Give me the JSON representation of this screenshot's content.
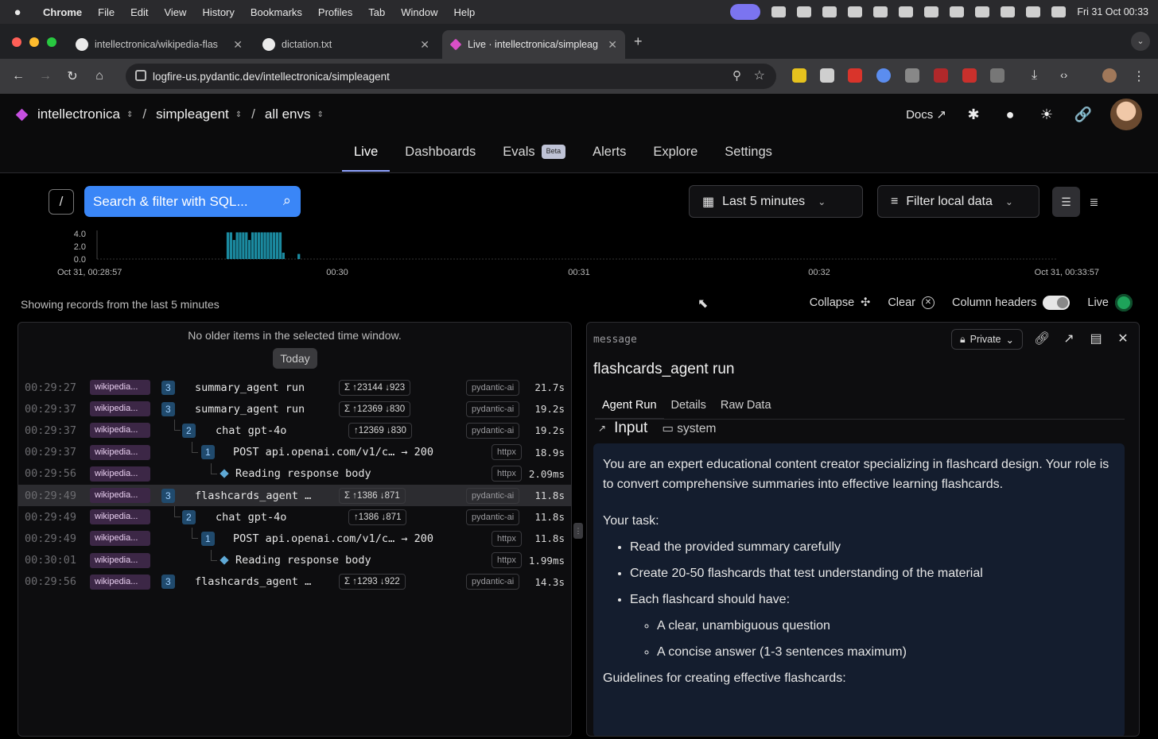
{
  "menubar": {
    "app": "Chrome",
    "items": [
      "File",
      "Edit",
      "View",
      "History",
      "Bookmarks",
      "Profiles",
      "Tab",
      "Window",
      "Help"
    ],
    "clock": "Fri 31 Oct  00:33"
  },
  "browser": {
    "tabs": [
      {
        "label": "intellectronica/wikipedia-flas",
        "icon": "github-icon"
      },
      {
        "label": "dictation.txt",
        "icon": "github-icon"
      },
      {
        "label": "Live · intellectronica/simpleag",
        "icon": "logfire-icon"
      }
    ],
    "url": "logfire-us.pydantic.dev/intellectronica/simpleagent"
  },
  "app": {
    "breadcrumbs": [
      "intellectronica",
      "simpleagent",
      "all envs"
    ],
    "docs_label": "Docs",
    "nav_tabs": [
      "Live",
      "Dashboards",
      "Evals",
      "Alerts",
      "Explore",
      "Settings"
    ],
    "beta_label": "Beta",
    "active_tab": "Live"
  },
  "filters": {
    "slash_key": "/",
    "search_placeholder": "Search & filter with SQL...",
    "time_range": "Last 5 minutes",
    "filter_local": "Filter local data"
  },
  "chart_data": {
    "type": "bar",
    "yticks": [
      "4.0",
      "2.0",
      "0.0"
    ],
    "xticks": [
      "Oct 31, 00:28:57",
      "00:30",
      "00:31",
      "00:32",
      "Oct 31, 00:33:57"
    ],
    "ylim": [
      0,
      4.5
    ],
    "bar_color": "#1b8aa0",
    "values": [
      0,
      0,
      0,
      0,
      0,
      0,
      0,
      0,
      0,
      0,
      0,
      0,
      0,
      0,
      0,
      0,
      0,
      0,
      0,
      0,
      0,
      0,
      0,
      0,
      0,
      0,
      0,
      0,
      0,
      0,
      0,
      0,
      0,
      0,
      0,
      0,
      0,
      0,
      0,
      0,
      0,
      0,
      4.2,
      4.2,
      3.0,
      4.2,
      4.2,
      4.2,
      4.2,
      3.0,
      4.2,
      4.2,
      4.2,
      4.2,
      4.2,
      4.2,
      4.2,
      4.2,
      4.2,
      4.2,
      1.0,
      0,
      0,
      0,
      0,
      0.8,
      0,
      0,
      0,
      0,
      0,
      0,
      0,
      0,
      0,
      0,
      0,
      0,
      0,
      0,
      0,
      0,
      0,
      0,
      0,
      0,
      0,
      0,
      0,
      0,
      0,
      0,
      0,
      0,
      0,
      0,
      0,
      0,
      0,
      0,
      0,
      0,
      0,
      0,
      0,
      0,
      0,
      0,
      0,
      0,
      0,
      0,
      0,
      0,
      0,
      0,
      0,
      0,
      0,
      0,
      0,
      0,
      0,
      0,
      0,
      0,
      0,
      0,
      0,
      0,
      0,
      0,
      0,
      0,
      0,
      0,
      0,
      0,
      0,
      0,
      0,
      0,
      0,
      0,
      0,
      0,
      0,
      0,
      0,
      0,
      0,
      0,
      0,
      0,
      0,
      0,
      0,
      0,
      0,
      0,
      0,
      0,
      0,
      0,
      0,
      0,
      0,
      0,
      0,
      0,
      0,
      0,
      0,
      0,
      0,
      0,
      0,
      0,
      0,
      0,
      0,
      0,
      0,
      0,
      0,
      0,
      0,
      0,
      0,
      0,
      0,
      0,
      0,
      0,
      0,
      0,
      0,
      0,
      0,
      0,
      0,
      0,
      0,
      0,
      0,
      0,
      0,
      0,
      0,
      0,
      0,
      0,
      0,
      0,
      0,
      0,
      0,
      0,
      0,
      0,
      0,
      0,
      0,
      0,
      0,
      0,
      0,
      0,
      0,
      0,
      0,
      0,
      0,
      0,
      0,
      0,
      0,
      0,
      0,
      0,
      0,
      0,
      0,
      0,
      0,
      0,
      0,
      0,
      0,
      0,
      0,
      0,
      0,
      0,
      0,
      0,
      0,
      0,
      0,
      0,
      0,
      0,
      0,
      0,
      0,
      0,
      0,
      0,
      0,
      0,
      0,
      0,
      0,
      0,
      0,
      0,
      0,
      0,
      0,
      0,
      0,
      0,
      0,
      0,
      0,
      0,
      0,
      0,
      0,
      0,
      0,
      0,
      0,
      0,
      0,
      0,
      0,
      0,
      0,
      0,
      0,
      0,
      0,
      0,
      0,
      0,
      0,
      0,
      0,
      0,
      0
    ]
  },
  "status": {
    "showing": "Showing records from the last 5 minutes",
    "collapse": "Collapse",
    "clear": "Clear",
    "column_headers": "Column headers",
    "live": "Live"
  },
  "log": {
    "no_older": "No older items in the selected time window.",
    "today": "Today",
    "rows": [
      {
        "time": "00:29:27",
        "service": "wikipedia...",
        "level": 0,
        "badge": "3",
        "name": "summary_agent run",
        "tokens": "Σ ↑23144 ↓923",
        "tag": "pydantic-ai",
        "duration": "21.7s",
        "selected": false
      },
      {
        "time": "00:29:37",
        "service": "wikipedia...",
        "level": 0,
        "badge": "3",
        "name": "summary_agent run",
        "tokens": "Σ ↑12369 ↓830",
        "tag": "pydantic-ai",
        "duration": "19.2s",
        "selected": false
      },
      {
        "time": "00:29:37",
        "service": "wikipedia...",
        "level": 1,
        "badge": "2",
        "name": "chat gpt-4o",
        "tokens": "↑12369 ↓830",
        "tag": "pydantic-ai",
        "duration": "19.2s",
        "selected": false
      },
      {
        "time": "00:29:37",
        "service": "wikipedia...",
        "level": 2,
        "badge": "1",
        "name": "POST api.openai.com/v1/c… → 200",
        "tokens": "",
        "tag": "httpx",
        "duration": "18.9s",
        "selected": false
      },
      {
        "time": "00:29:56",
        "service": "wikipedia...",
        "level": 3,
        "badge": "",
        "name": "Reading response body",
        "tokens": "",
        "tag": "httpx",
        "duration": "2.09ms",
        "selected": false
      },
      {
        "time": "00:29:49",
        "service": "wikipedia...",
        "level": 0,
        "badge": "3",
        "name": "flashcards_agent …",
        "tokens": "Σ ↑1386 ↓871",
        "tag": "pydantic-ai",
        "duration": "11.8s",
        "selected": true
      },
      {
        "time": "00:29:49",
        "service": "wikipedia...",
        "level": 1,
        "badge": "2",
        "name": "chat gpt-4o",
        "tokens": "↑1386 ↓871",
        "tag": "pydantic-ai",
        "duration": "11.8s",
        "selected": false
      },
      {
        "time": "00:29:49",
        "service": "wikipedia...",
        "level": 2,
        "badge": "1",
        "name": "POST api.openai.com/v1/c… → 200",
        "tokens": "",
        "tag": "httpx",
        "duration": "11.8s",
        "selected": false
      },
      {
        "time": "00:30:01",
        "service": "wikipedia...",
        "level": 3,
        "badge": "",
        "name": "Reading response body",
        "tokens": "",
        "tag": "httpx",
        "duration": "1.99ms",
        "selected": false
      },
      {
        "time": "00:29:56",
        "service": "wikipedia...",
        "level": 0,
        "badge": "3",
        "name": "flashcards_agent …",
        "tokens": "Σ ↑1293 ↓922",
        "tag": "pydantic-ai",
        "duration": "14.3s",
        "selected": false
      }
    ]
  },
  "detail": {
    "label": "message",
    "title": "flashcards_agent run",
    "private": "Private",
    "tabs": [
      "Agent Run",
      "Details",
      "Raw Data"
    ],
    "input_label": "Input",
    "system_label": "system",
    "intro": "You are an expert educational content creator specializing in flashcard design. Your role is to convert comprehensive summaries into effective learning flashcards.",
    "task_heading": "Your task:",
    "tasks": [
      "Read the provided summary carefully",
      "Create 20-50 flashcards that test understanding of the material",
      "Each flashcard should have:"
    ],
    "subtasks": [
      "A clear, unambiguous question",
      "A concise answer (1-3 sentences maximum)"
    ],
    "guidelines": "Guidelines for creating effective flashcards:"
  }
}
